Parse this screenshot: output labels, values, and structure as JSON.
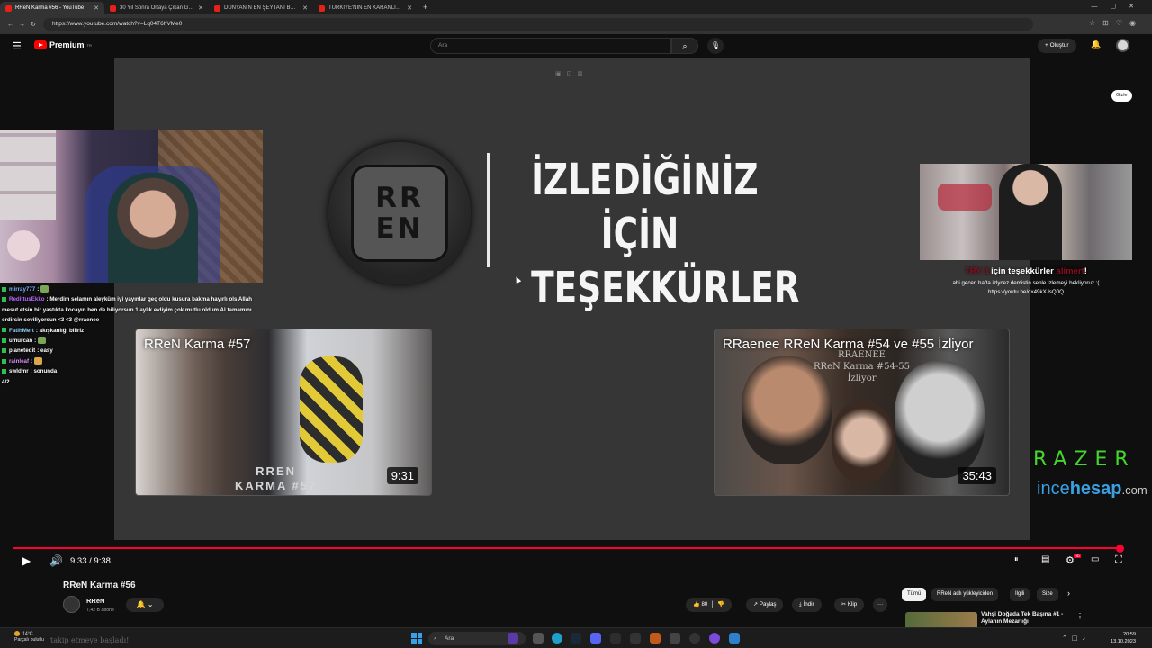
{
  "browser": {
    "tabs": [
      {
        "label": "RReN Karma #56 - YouTube",
        "active": true
      },
      {
        "label": "30 Yıl Sonra Ortaya Çıkan Gerçek",
        "active": false
      },
      {
        "label": "DÜNYANIN EN ŞEYTANİ BANKA",
        "active": false
      },
      {
        "label": "TÜRKİYE'NİN EN KARANLIK SERİ",
        "active": false
      }
    ],
    "new_tab": "+",
    "url": "https://www.youtube.com/watch?v=Lq04T6hVMe0"
  },
  "header": {
    "logo_text": "Premium",
    "logo_sup": "TR",
    "search_placeholder": "Ara",
    "create_label": "+ Oluştur"
  },
  "video_frame": {
    "logo_lines": [
      "RR",
      "EN"
    ],
    "thanks_lines": [
      "İZLEDİĞİNİZ İÇİN",
      "TEŞEKKÜRLER"
    ],
    "endcards": [
      {
        "title": "RReN Karma #57",
        "duration": "9:31",
        "watermark": [
          "RREN",
          "KARMA #57"
        ]
      },
      {
        "title": "RRaenee RReN Karma #54 ve #55 İzliyor",
        "duration": "35:43",
        "watermark": [
          "RRAENEE",
          "RReN Karma #54-55",
          "İzliyor"
        ]
      }
    ],
    "chat": [
      {
        "user": "mirray777",
        "text": ":",
        "color": "#7fb2ff",
        "emote": true
      },
      {
        "user": "RedittusEkko",
        "text": ": Merdim selamın aleyküm iyi yayınlar geç oldu kusura bakma hayırlı ols Allah mesut etsin bir yastıkta kocayın ben de biliyorsun 1 aylık evliyim çok mutlu oldum Al tamamını erdirsin seviliyorsun <3 <3 @rraenee",
        "color": "#b86bff",
        "emote": false
      },
      {
        "user": "FatihMert",
        "text": ": akışkanlığı billriz",
        "color": "#8fd4ff",
        "emote": false
      },
      {
        "user": "umurcan",
        "text": ":",
        "color": "#ffffff",
        "emote": true
      },
      {
        "user": "planetedit",
        "text": ": easy",
        "color": "#ffffff",
        "emote": false
      },
      {
        "user": "rainleaf",
        "text": ":",
        "color": "#e08dff",
        "emote": true
      },
      {
        "user": "swldmr",
        "text": ": sonunda",
        "color": "#ffffff",
        "emote": false
      },
      {
        "user": "",
        "text": "4/2",
        "color": "#ffffff",
        "emote": false
      }
    ],
    "donation": {
      "amount": "TRY 3",
      "middle": "için teşekkürler",
      "name": "alimert",
      "end": "!",
      "message_lines": [
        "abi gecen hafta izlycez demistin senle izlemeyi bekliyoruz :(",
        "https://youtu.be/dx49kXJsQ0Q"
      ]
    },
    "hide_button": "Gizle",
    "sponsor1": "RAZER",
    "sponsor2_a": "ince",
    "sponsor2_b": "hesap",
    "sponsor2_c": ".com"
  },
  "player": {
    "time": "9:33 / 9:38",
    "progress_fraction": 0.995
  },
  "below": {
    "title": "RReN Karma #56",
    "channel": "RReN",
    "subscribers": "7,42 B abone",
    "bell": "🔔 ⌄",
    "actions": {
      "likes": "80",
      "share": "Paylaş",
      "download": "İndir",
      "clip": "Klip",
      "more": "···"
    },
    "chips": [
      "Tümü",
      "RReN adlı yükleyiciden",
      "İlgili",
      "Size"
    ],
    "rec_title": "Vahşi Doğada Tek Başına #1 - Aylanın Mezarlığı"
  },
  "taskbar": {
    "weather_temp": "14°C",
    "weather_text": "Parçalı bulutlu",
    "ghost": "takip etmeye başladı!",
    "search": "Ara",
    "time": "20:59",
    "date": "13.10.2023"
  }
}
